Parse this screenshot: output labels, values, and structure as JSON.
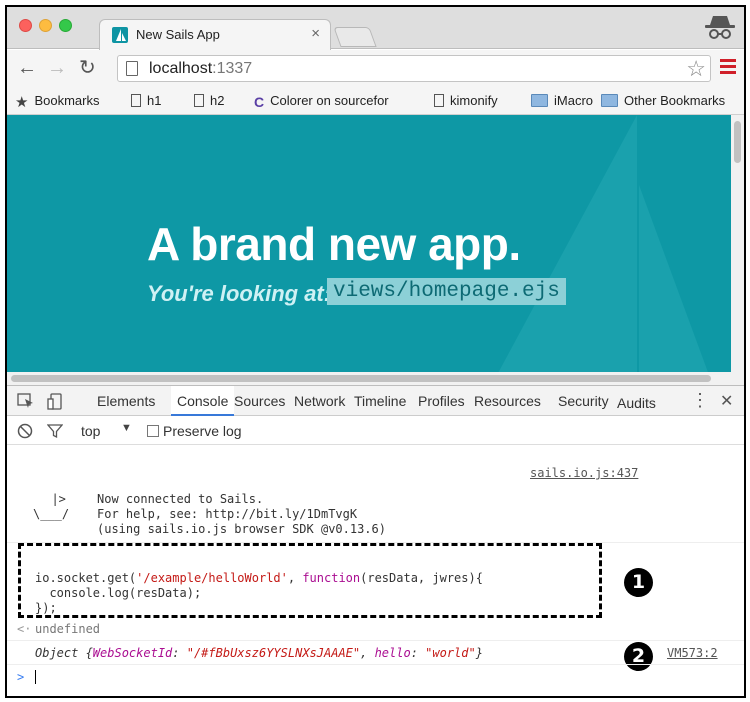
{
  "browser": {
    "tab_title": "New Sails App",
    "tab_close": "×",
    "url_host": "localhost",
    "url_port": ":1337",
    "back_icon": "←",
    "forward_icon": "→",
    "reload_icon": "↻",
    "star_icon": "☆"
  },
  "bookmarks": [
    {
      "label": "Bookmarks",
      "icon": "star-icon"
    },
    {
      "label": "h1",
      "icon": "page-icon"
    },
    {
      "label": "h2",
      "icon": "page-icon"
    },
    {
      "label": "Colorer on sourcefor",
      "icon": "colorer-icon"
    },
    {
      "label": "kimonify",
      "icon": "page-icon"
    },
    {
      "label": "iMacro",
      "icon": "folder-icon"
    },
    {
      "label": "Other Bookmarks",
      "icon": "folder-icon"
    }
  ],
  "page": {
    "title": "A brand new app.",
    "subtitle": "You're looking at:",
    "code": "views/homepage.ejs"
  },
  "devtools": {
    "tabs": [
      "Elements",
      "Console",
      "Sources",
      "Network",
      "Timeline",
      "Profiles",
      "Resources",
      "Security",
      "Audits"
    ],
    "active_tab": "Console",
    "context": "top",
    "preserve_log": "Preserve log",
    "close_icon": "✕",
    "more_icon": "⋮"
  },
  "console": {
    "source1": "sails.io.js:437",
    "boat_line1": "  |>",
    "boat_line2": "\\___/",
    "msg1": "Now connected to Sails.",
    "msg2": "For help, see: http://bit.ly/1DmTvgK",
    "msg3": "(using sails.io.js browser SDK @v0.13.6)",
    "code1_a": "io.socket.get(",
    "code1_str": "'/example/helloWorld'",
    "code1_b": ", ",
    "code1_kw": "function",
    "code1_c": "(resData, jwres){",
    "code2": "  console.log(resData);",
    "code3": "});",
    "result_prefix": "<·",
    "result": "undefined",
    "obj_a": "Object {",
    "obj_key1": "WebSocketId",
    "obj_colon1": ": ",
    "obj_val1": "\"/#fBbUxsz6YYSLNXsJAAAE\"",
    "obj_sep": ", ",
    "obj_key2": "hello",
    "obj_colon2": ": ",
    "obj_val2": "\"world\"",
    "obj_end": "}",
    "source2": "VM573:2",
    "prompt": ">",
    "badge1": "1",
    "badge2": "2"
  }
}
